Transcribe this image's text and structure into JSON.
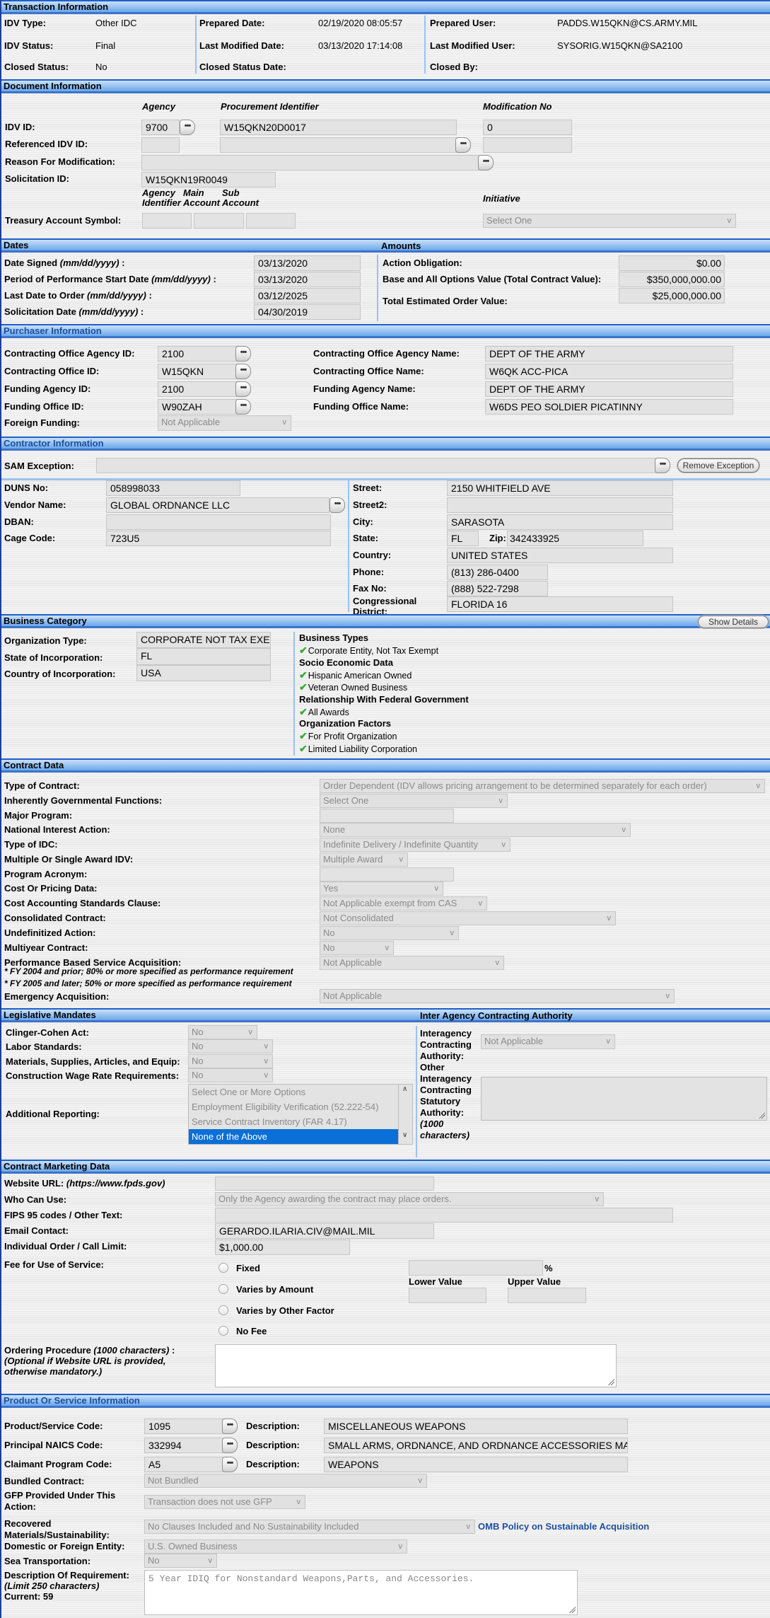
{
  "transaction": {
    "title": "Transaction Information",
    "idv_type_label": "IDV Type:",
    "idv_type": "Other IDC",
    "idv_status_label": "IDV Status:",
    "idv_status": "Final",
    "closed_status_label": "Closed Status:",
    "closed_status": "No",
    "prepared_date_label": "Prepared Date:",
    "prepared_date": "02/19/2020 08:05:57",
    "last_modified_date_label": "Last Modified Date:",
    "last_modified_date": "03/13/2020 17:14:08",
    "closed_status_date_label": "Closed Status Date:",
    "prepared_user_label": "Prepared User:",
    "prepared_user": "PADDS.W15QKN@CS.ARMY.MIL",
    "last_modified_user_label": "Last Modified User:",
    "last_modified_user": "SYSORIG.W15QKN@SA2100",
    "closed_by_label": "Closed By:"
  },
  "document": {
    "title": "Document Information",
    "col_agency": "Agency",
    "col_procurement": "Procurement Identifier",
    "col_mod": "Modification No",
    "idv_id_label": "IDV ID:",
    "idv_agency": "9700",
    "idv_proc": "W15QKN20D0017",
    "idv_mod": "0",
    "ref_idv_label": "Referenced IDV ID:",
    "reason_label": "Reason For Modification:",
    "solicitation_label": "Solicitation ID:",
    "solicitation": "W15QKN19R0049",
    "tas_agency_id": "Agency Identifier",
    "tas_main": "Main Account",
    "tas_sub": "Sub Account",
    "initiative_label": "Initiative",
    "initiative": "Select One",
    "tas_label": "Treasury Account Symbol:"
  },
  "dates": {
    "title": "Dates",
    "signed_label": "Date Signed ",
    "signed": "03/13/2020",
    "pop_label": "Period of Performance Start Date ",
    "pop": "03/13/2020",
    "last_order_label": "Last Date to Order ",
    "last_order": "03/12/2025",
    "solicit_label": "Solicitation Date ",
    "solicit": "04/30/2019",
    "fmt": "(mm/dd/yyyy)"
  },
  "amounts": {
    "title": "Amounts",
    "obligation_label": "Action Obligation:",
    "obligation": "$0.00",
    "base_label": "Base and All Options Value (Total Contract Value):",
    "base": "$350,000,000.00",
    "estimated_label": "Total Estimated Order Value:",
    "estimated": "$25,000,000.00"
  },
  "purchaser": {
    "title": "Purchaser Information",
    "rows": [
      {
        "label": "Contracting Office Agency ID:",
        "value": "2100",
        "name_label": "Contracting Office Agency Name:",
        "name": "DEPT OF THE ARMY"
      },
      {
        "label": "Contracting Office ID:",
        "value": "W15QKN",
        "name_label": "Contracting Office Name:",
        "name": "W6QK ACC-PICA"
      },
      {
        "label": "Funding Agency ID:",
        "value": "2100",
        "name_label": "Funding Agency Name:",
        "name": "DEPT OF THE ARMY"
      },
      {
        "label": "Funding Office ID:",
        "value": "W90ZAH",
        "name_label": "Funding Office Name:",
        "name": "W6DS PEO SOLDIER PICATINNY"
      }
    ],
    "foreign_label": "Foreign Funding:",
    "foreign": "Not Applicable"
  },
  "contractor": {
    "title": "Contractor Information",
    "sam_label": "SAM Exception:",
    "remove_btn": "Remove Exception",
    "duns_label": "DUNS No:",
    "duns": "058998033",
    "vendor_label": "Vendor Name:",
    "vendor": "GLOBAL ORDNANCE LLC",
    "dban_label": "DBAN:",
    "cage_label": "Cage Code:",
    "cage": "723U5",
    "street_label": "Street:",
    "street": "2150 WHITFIELD AVE",
    "street2_label": "Street2:",
    "city_label": "City:",
    "city": "SARASOTA",
    "state_label": "State:",
    "state": "FL",
    "zip_label": "Zip:",
    "zip": "342433925",
    "country_label": "Country:",
    "country": "UNITED STATES",
    "phone_label": "Phone:",
    "phone": "(813) 286-0400",
    "fax_label": "Fax No:",
    "fax": "(888) 522-7298",
    "district_label": "Congressional District:",
    "district": "FLORIDA 16"
  },
  "business": {
    "title": "Business Category",
    "show_details": "Show Details",
    "org_type_label": "Organization Type:",
    "org_type": "CORPORATE NOT TAX EXE",
    "state_label": "State of Incorporation:",
    "state": "FL",
    "country_label": "Country of Incorporation:",
    "country": "USA",
    "groups": [
      {
        "heading": "Business Types",
        "items": [
          "Corporate Entity, Not Tax Exempt"
        ]
      },
      {
        "heading": "Socio Economic Data",
        "items": [
          "Hispanic American Owned",
          "Veteran Owned Business"
        ]
      },
      {
        "heading": "Relationship With Federal Government",
        "items": [
          "All Awards"
        ]
      },
      {
        "heading": "Organization Factors",
        "items": [
          "For Profit Organization",
          "Limited Liability Corporation"
        ]
      }
    ]
  },
  "contract": {
    "title": "Contract Data",
    "rows": [
      {
        "label": "Type of Contract:",
        "value": "Order Dependent (IDV allows pricing arrangement to be determined separately for each order)"
      },
      {
        "label": "Inherently Governmental Functions:",
        "value": "Select One"
      },
      {
        "label": "Major Program:",
        "value": ""
      },
      {
        "label": "National Interest Action:",
        "value": "None"
      },
      {
        "label": "Type of IDC:",
        "value": "Indefinite Delivery / Indefinite Quantity"
      },
      {
        "label": "Multiple Or Single Award IDV:",
        "value": "Multiple Award"
      },
      {
        "label": "Program Acronym:",
        "value": ""
      },
      {
        "label": "Cost Or Pricing Data:",
        "value": "Yes"
      },
      {
        "label": "Cost Accounting Standards Clause:",
        "value": "Not Applicable exempt from CAS"
      },
      {
        "label": "Consolidated Contract:",
        "value": "Not Consolidated"
      },
      {
        "label": "Undefinitized Action:",
        "value": "No"
      },
      {
        "label": "Multiyear Contract:",
        "value": "No"
      },
      {
        "label": "Performance Based Service Acquisition:",
        "value": "Not Applicable"
      }
    ],
    "note1": "* FY 2004 and prior; 80% or more specified as performance requirement",
    "note2": "* FY 2005 and later; 50% or more specified as performance requirement",
    "emergency_label": "Emergency Acquisition:",
    "emergency": "Not Applicable"
  },
  "legislative": {
    "title": "Legislative Mandates",
    "rows": [
      {
        "label": "Clinger-Cohen Act:",
        "value": "No"
      },
      {
        "label": "Labor Standards:",
        "value": "No"
      },
      {
        "label": "Materials, Supplies, Articles, and Equip:",
        "value": "No"
      },
      {
        "label": "Construction Wage Rate Requirements:",
        "value": "No"
      }
    ],
    "additional_label": "Additional Reporting:",
    "options": [
      "Select One or More Options",
      "Employment Eligibility Verification (52.222-54)",
      "Service Contract Inventory (FAR 4.17)",
      "None of the Above"
    ],
    "selected_option": "None of the Above"
  },
  "interagency": {
    "title": "Inter Agency Contracting Authority",
    "authority_label": "Interagency Contracting Authority:",
    "authority": "Not Applicable",
    "other_label": "Other Interagency Contracting Statutory Authority:",
    "other_hint": "(1000 characters)"
  },
  "marketing": {
    "title": "Contract Marketing Data",
    "website_label": "Website URL: ",
    "website_hint": "(https://www.fpds.gov)",
    "who_label": "Who Can Use:",
    "who": "Only the Agency awarding the contract may place orders.",
    "fips_label": "FIPS 95 codes / Other Text:",
    "email_label": "Email Contact:",
    "email": "GERARDO.ILARIA.CIV@MAIL.MIL",
    "limit_label": "Individual Order / Call Limit:",
    "limit": "$1,000.00",
    "fee_label": "Fee for Use of Service:",
    "fee_options": [
      "Fixed",
      "Varies by Amount",
      "Varies by Other Factor",
      "No Fee"
    ],
    "percent": "%",
    "lower": "Lower Value",
    "upper": "Upper Value",
    "ordering_label": "Ordering Procedure ",
    "ordering_hint": "(1000 characters)",
    "ordering_note": "(Optional if Website URL is provided, otherwise mandatory.)"
  },
  "product": {
    "title": "Product Or Service Information",
    "codes": [
      {
        "label": "Product/Service Code:",
        "value": "1095",
        "desc": "MISCELLANEOUS WEAPONS"
      },
      {
        "label": "Principal NAICS Code:",
        "value": "332994",
        "desc": "SMALL ARMS, ORDNANCE, AND ORDNANCE ACCESSORIES MAN"
      },
      {
        "label": "Claimant Program Code:",
        "value": "A5",
        "desc": "WEAPONS"
      }
    ],
    "desc_label": "Description:",
    "bundled_label": "Bundled Contract:",
    "bundled": "Not Bundled",
    "gfp_label": "GFP Provided Under This Action:",
    "gfp": "Transaction does not use GFP",
    "recovered_label": "Recovered Materials/Sustainability:",
    "recovered": "No Clauses Included and No Sustainability Included",
    "omb_link": "OMB Policy on Sustainable Acquisition",
    "domestic_label": "Domestic or Foreign Entity:",
    "domestic": "U.S. Owned Business",
    "sea_label": "Sea Transportation:",
    "sea": "No",
    "req_label": "Description Of Requirement:",
    "req_hint": "(Limit 250 characters)",
    "req_count": "Current: 59",
    "req_text": "5 Year IDIQ for Nonstandard Weapons,Parts, and Accessories."
  }
}
